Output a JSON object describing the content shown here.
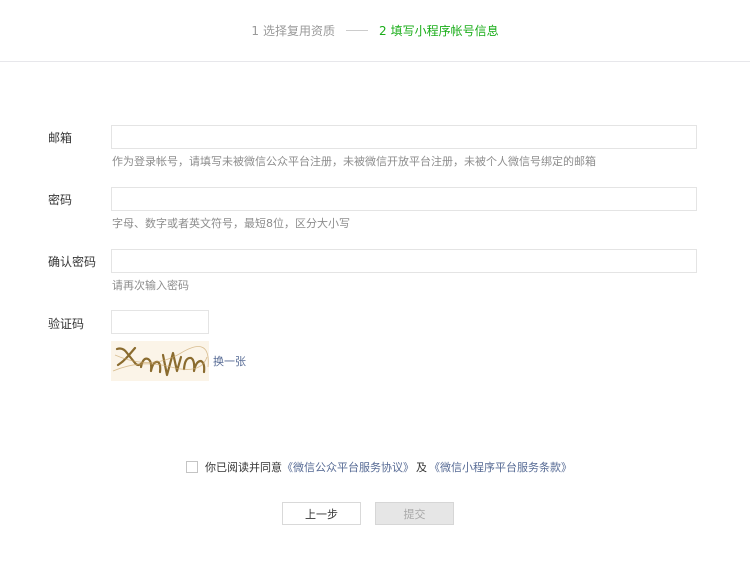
{
  "steps": {
    "step1": {
      "num": "1",
      "label": "选择复用资质"
    },
    "step2": {
      "num": "2",
      "label": "填写小程序帐号信息"
    }
  },
  "form": {
    "email": {
      "label": "邮箱",
      "value": "",
      "hint": "作为登录帐号，请填写未被微信公众平台注册，未被微信开放平台注册，未被个人微信号绑定的邮箱"
    },
    "password": {
      "label": "密码",
      "value": "",
      "hint": "字母、数字或者英文符号，最短8位，区分大小写"
    },
    "confirm_password": {
      "label": "确认密码",
      "value": "",
      "hint": "请再次输入密码"
    },
    "captcha": {
      "label": "验证码",
      "value": "",
      "refresh_label": "换一张"
    }
  },
  "agreement": {
    "checked": false,
    "prefix": "你已阅读并同意",
    "link1": "《微信公众平台服务协议》",
    "and": "及",
    "link2": "《微信小程序平台服务条款》"
  },
  "buttons": {
    "prev": "上一步",
    "submit": "提交"
  },
  "colors": {
    "accent_green": "#1aad19",
    "link_blue": "#576b95",
    "hint_gray": "#8d8d8d",
    "disabled_bg": "#e6e6e6"
  },
  "icons": {
    "captcha": "captcha-image"
  }
}
